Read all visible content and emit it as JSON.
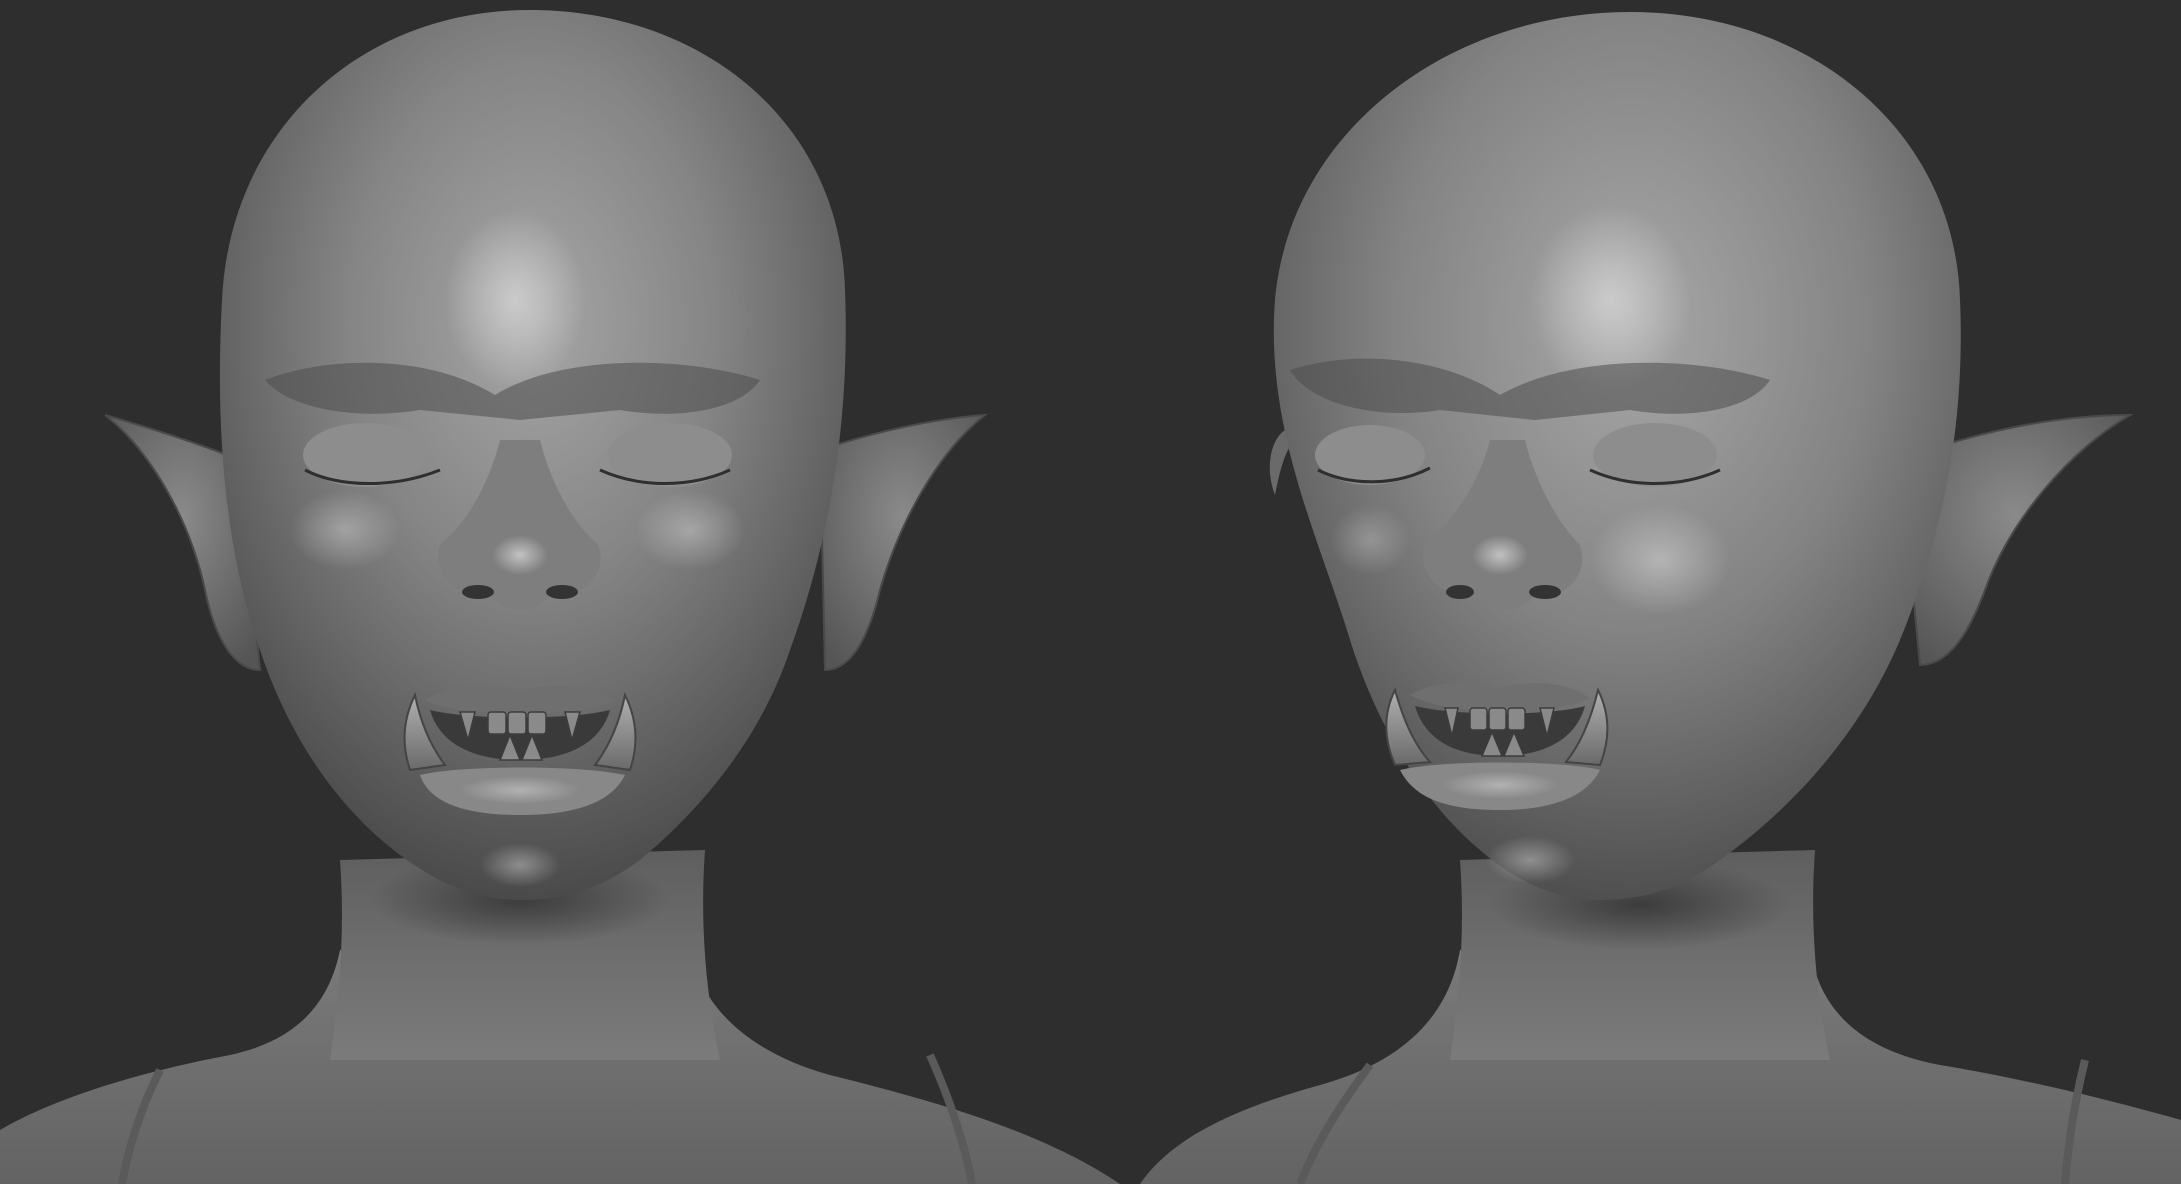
{
  "scene": {
    "background_color": "#2e2e2e",
    "clay_color": "#7a7a7a",
    "views": [
      {
        "subject": "orc-female-bust",
        "angle": "front"
      },
      {
        "subject": "orc-female-bust",
        "angle": "three-quarter"
      }
    ]
  }
}
